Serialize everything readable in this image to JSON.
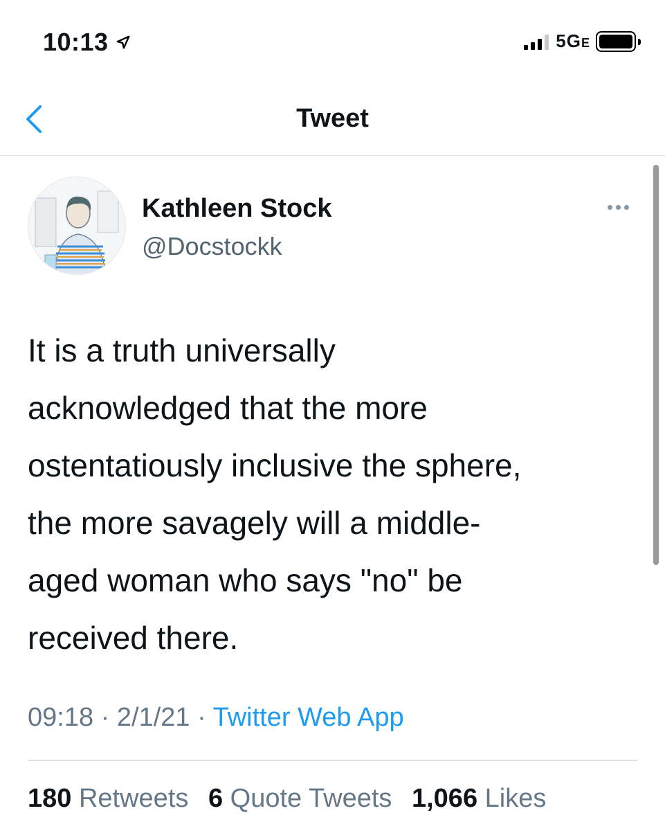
{
  "status_bar": {
    "time": "10:13",
    "network": "5G",
    "network_suffix": "E",
    "location_icon": "location-arrow-icon",
    "battery_icon": "battery-full-icon"
  },
  "nav": {
    "title": "Tweet",
    "back_icon": "chevron-left-icon"
  },
  "author": {
    "name": "Kathleen Stock",
    "handle": "@Docstockk"
  },
  "tweet": {
    "lines": [
      "It is a truth universally",
      "acknowledged that the more",
      "ostentatiously inclusive the sphere,",
      "the more savagely will a middle-",
      "aged woman who says \"no\" be",
      "received there."
    ]
  },
  "meta": {
    "time": "09:18",
    "date": "2/1/21",
    "separator": "·",
    "source": "Twitter Web App"
  },
  "stats": {
    "retweets_count": "180",
    "retweets_label": "Retweets",
    "quotes_count": "6",
    "quotes_label": "Quote Tweets",
    "likes_count": "1,066",
    "likes_label": "Likes"
  },
  "colors": {
    "link": "#1d9bf0",
    "secondary_text": "#657786",
    "primary_text": "#0f1419"
  }
}
